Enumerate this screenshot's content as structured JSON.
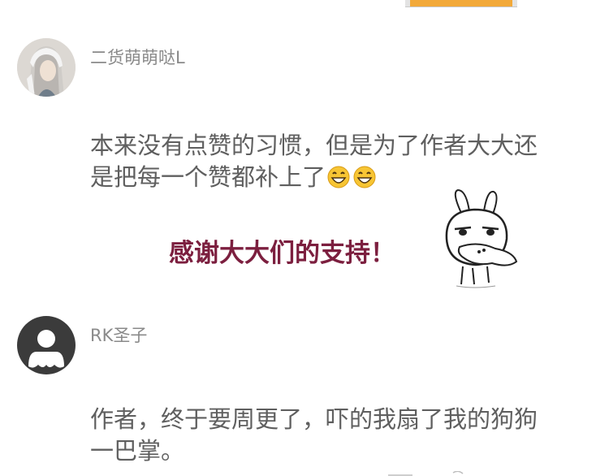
{
  "comments": [
    {
      "username": "二货萌萌哒L",
      "text_line1": "本来没有点赞的习惯，但是为了作者大大还",
      "text_line2": "是把每一个赞都补上了",
      "emojis": [
        "grinning-face-icon",
        "grinning-face-icon"
      ],
      "sticker_caption": "感谢大大们的支持！",
      "sticker": "rabbit-sticker-icon"
    },
    {
      "username": "RK圣子",
      "text_line1": "作者，终于要周更了，吓的我扇了我的狗狗",
      "text_line2": "一巴掌。"
    }
  ],
  "colors": {
    "username": "#8a8a8a",
    "comment_text": "#5f5f5f",
    "caption": "#7c1f3f",
    "emoji": "#f7c534"
  }
}
